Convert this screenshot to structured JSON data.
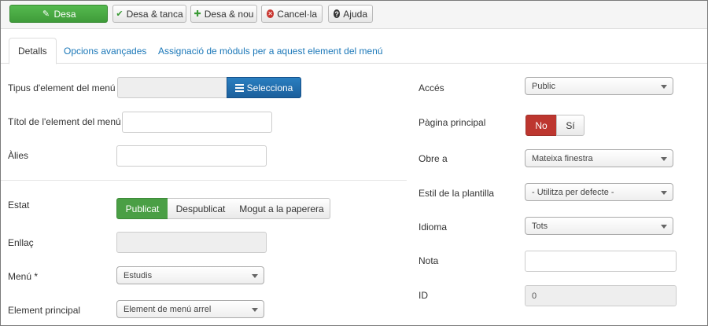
{
  "toolbar": {
    "save": "Desa",
    "save_close": "Desa & tanca",
    "save_new": "Desa & nou",
    "cancel": "Cancel·la",
    "help": "Ajuda"
  },
  "tabs": [
    {
      "label": "Detalls",
      "active": true
    },
    {
      "label": "Opcions avançades",
      "active": false
    },
    {
      "label": "Assignació de mòduls per a aquest element del menú",
      "active": false
    }
  ],
  "left": {
    "type_label": "Tipus d'element del menú *",
    "type_value": "",
    "select_button": "Selecciona",
    "title_label": "Títol de l'element del menú *",
    "title_value": "",
    "alias_label": "Àlies",
    "alias_value": "",
    "status_label": "Estat",
    "status_options": [
      "Publicat",
      "Despublicat",
      "Mogut a la paperera"
    ],
    "status_selected": "Publicat",
    "link_label": "Enllaç",
    "link_value": "",
    "menu_label": "Menú *",
    "menu_value": "Estudis",
    "parent_label": "Element principal",
    "parent_value": "Element de menú arrel"
  },
  "right": {
    "access_label": "Accés",
    "access_value": "Public",
    "home_label": "Pàgina principal",
    "home_options": [
      "No",
      "Sí"
    ],
    "home_selected": "No",
    "opens_label": "Obre a",
    "opens_value": "Mateixa finestra",
    "style_label": "Estil de la plantilla",
    "style_value": "- Utilitza per defecte -",
    "language_label": "Idioma",
    "language_value": "Tots",
    "note_label": "Nota",
    "note_value": "",
    "id_label": "ID",
    "id_value": "0"
  },
  "colors": {
    "primary_green": "#4a9f45",
    "select_blue": "#1b5f9c",
    "no_red": "#bd362f",
    "tab_link": "#1a77b8"
  },
  "icons": {
    "save": "edit-icon",
    "save_close": "check-icon",
    "save_new": "plus-icon",
    "cancel": "cancel-circle-icon",
    "help": "question-circle-icon",
    "select": "list-icon"
  }
}
